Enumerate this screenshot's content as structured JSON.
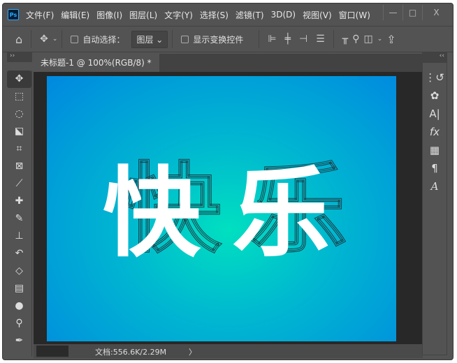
{
  "app": {
    "logo": "Ps"
  },
  "menu": [
    "文件(F)",
    "编辑(E)",
    "图像(I)",
    "图层(L)",
    "文字(Y)",
    "选择(S)",
    "滤镜(T)",
    "3D(D)",
    "视图(V)",
    "窗口(W)"
  ],
  "window_controls": {
    "minimize": "—",
    "maximize": "□",
    "close": "X"
  },
  "options": {
    "auto_select_label": "自动选择：",
    "layer_select": "图层",
    "show_transform_label": "显示变换控件"
  },
  "tab": {
    "title": "未标题-1 @ 100%(RGB/8) *",
    "close": "×"
  },
  "canvas": {
    "text_chars": [
      "快",
      "乐"
    ]
  },
  "status": {
    "doc_info": "文档:556.6K/2.29M",
    "arrow": "〉"
  },
  "panel_collapse": {
    "left": "››",
    "right": "‹‹"
  },
  "right_panel_icons": [
    "history-icon",
    "color-palette-icon",
    "character-icon",
    "fx-icon",
    "swatches-icon",
    "paragraph-icon",
    "glyphs-icon"
  ]
}
